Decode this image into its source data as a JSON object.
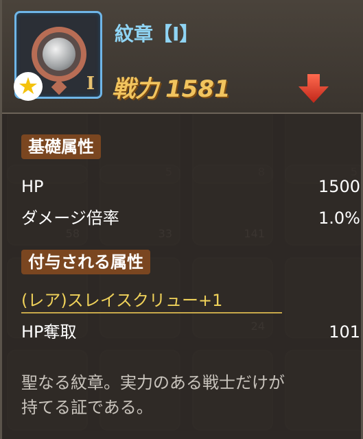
{
  "item": {
    "name": "紋章【Ⅰ】",
    "tier": "I",
    "power_label": "戦力",
    "power_value": "1581"
  },
  "basic": {
    "title": "基礎属性",
    "stats": [
      {
        "label": "HP",
        "value": "1500"
      },
      {
        "label": "ダメージ倍率",
        "value": "1.0%"
      }
    ]
  },
  "bonus": {
    "title": "付与される属性",
    "name": "(レア)スレイスクリュー+1",
    "stats": [
      {
        "label": "HP奪取",
        "value": "101"
      }
    ]
  },
  "description": {
    "line1": "聖なる紋章。実力のある戦士だけが",
    "line2": "持てる証である。"
  },
  "background_counts": [
    "5",
    "8",
    "5",
    "58",
    "33",
    "141",
    "24"
  ],
  "colors": {
    "accent_blue": "#8fd4f4",
    "power_gold": "#f1c45e",
    "bonus_gold": "#f0d25a",
    "section_tag": "#7a4620",
    "arrow_red": "#e5452f"
  }
}
